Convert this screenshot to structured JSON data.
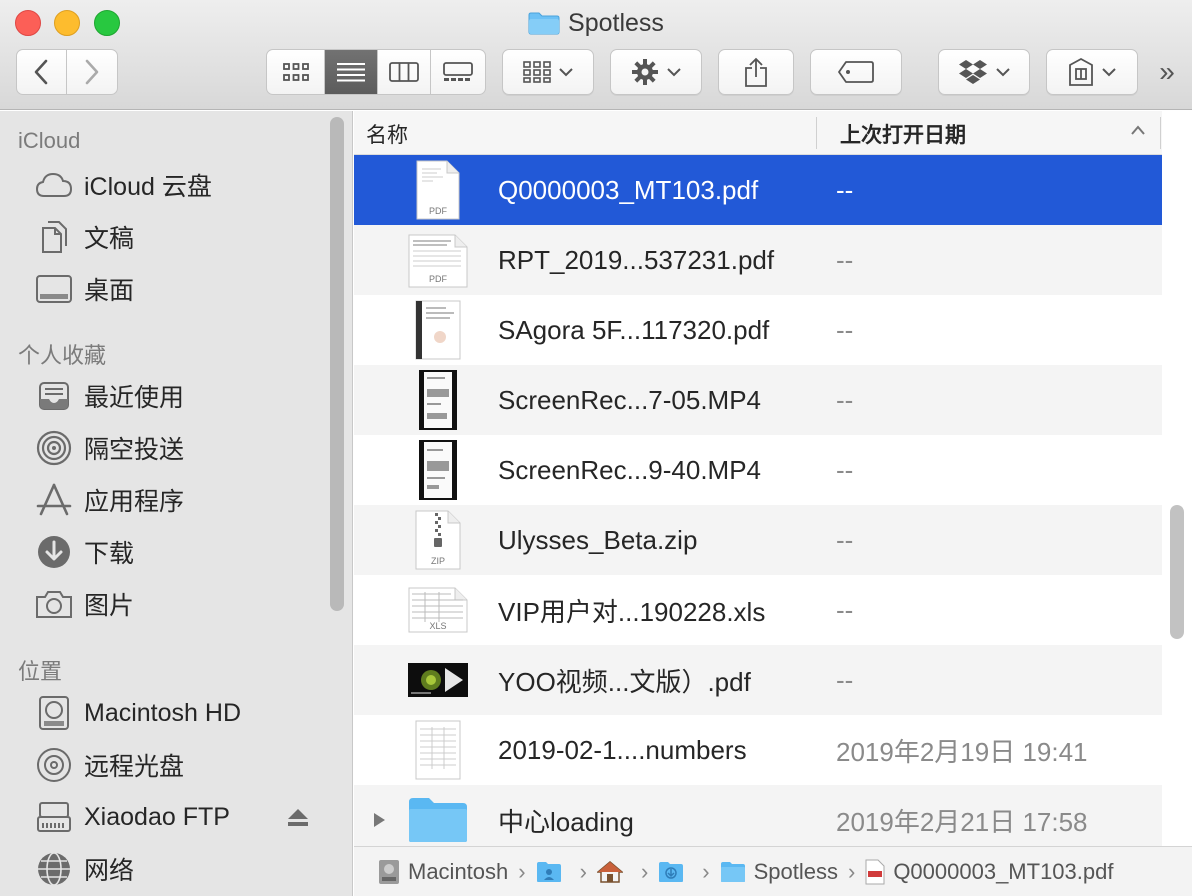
{
  "window": {
    "title": "Spotless"
  },
  "toolbar": {
    "back_icon": "chevron-left-icon",
    "forward_icon": "chevron-right-icon",
    "overflow_label": "»"
  },
  "sidebar": {
    "sections": [
      {
        "heading": "iCloud",
        "items": [
          {
            "label": "iCloud 云盘",
            "icon": "cloud-icon"
          },
          {
            "label": "文稿",
            "icon": "documents-icon"
          },
          {
            "label": "桌面",
            "icon": "desktop-icon"
          }
        ]
      },
      {
        "heading": "个人收藏",
        "items": [
          {
            "label": "最近使用",
            "icon": "recents-icon"
          },
          {
            "label": "隔空投送",
            "icon": "airdrop-icon"
          },
          {
            "label": "应用程序",
            "icon": "applications-icon"
          },
          {
            "label": "下载",
            "icon": "downloads-icon"
          },
          {
            "label": "图片",
            "icon": "camera-icon"
          }
        ]
      },
      {
        "heading": "位置",
        "items": [
          {
            "label": "Macintosh HD",
            "icon": "hard-drive-icon"
          },
          {
            "label": "远程光盘",
            "icon": "optical-disc-icon"
          },
          {
            "label": "Xiaodao FTP",
            "icon": "network-drive-icon"
          },
          {
            "label": "网络",
            "icon": "globe-icon"
          }
        ]
      }
    ]
  },
  "list": {
    "columns": {
      "name": "名称",
      "date": "上次打开日期"
    },
    "rows": [
      {
        "name": "Q0000003_MT103.pdf",
        "date": "--",
        "kind": "pdf",
        "selected": true
      },
      {
        "name": "RPT_2019...537231.pdf",
        "date": "--",
        "kind": "pdf"
      },
      {
        "name": "SAgora 5F...117320.pdf",
        "date": "--",
        "kind": "pdf-doc"
      },
      {
        "name": "ScreenRec...7-05.MP4",
        "date": "--",
        "kind": "video"
      },
      {
        "name": "ScreenRec...9-40.MP4",
        "date": "--",
        "kind": "video"
      },
      {
        "name": "Ulysses_Beta.zip",
        "date": "--",
        "kind": "zip"
      },
      {
        "name": "VIP用户对...190228.xls",
        "date": "--",
        "kind": "xls"
      },
      {
        "name": "YOO视频...文版）.pdf",
        "date": "--",
        "kind": "pdf-image"
      },
      {
        "name": "2019-02-1....numbers",
        "date": "2019年2月19日 19:41",
        "kind": "numbers"
      },
      {
        "name": "中心loading",
        "date": "2019年2月21日 17:58",
        "kind": "folder"
      }
    ],
    "file_icon_labels": {
      "pdf": "PDF",
      "zip": "ZIP",
      "xls": "XLS"
    }
  },
  "pathbar": {
    "items": [
      {
        "label": "Macintosh",
        "icon": "hard-drive-icon"
      },
      {
        "label": "",
        "icon": "user-folder-icon"
      },
      {
        "label": "",
        "icon": "home-icon"
      },
      {
        "label": "",
        "icon": "downloads-folder-icon"
      },
      {
        "label": "Spotless",
        "icon": "folder-icon"
      },
      {
        "label": "Q0000003_MT103.pdf",
        "icon": "pdf-file-icon"
      }
    ],
    "separator": "›"
  },
  "colors": {
    "selection": "#2259d7",
    "folder": "#5ab8f2",
    "sidebar_bg": "#e5e5e5"
  }
}
